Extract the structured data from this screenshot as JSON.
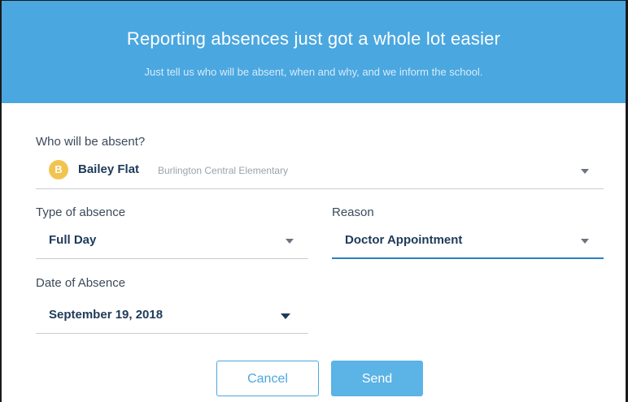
{
  "banner": {
    "title": "Reporting absences just got a whole lot easier",
    "subtitle": "Just tell us who will be absent, when and why, and we inform the school."
  },
  "student_field": {
    "label": "Who will be absent?",
    "avatar_initial": "B",
    "student_name": "Bailey Flat",
    "school": "Burlington Central Elementary",
    "icon": "caret-down-icon"
  },
  "type_field": {
    "label": "Type of absence",
    "value": "Full Day",
    "icon": "caret-down-icon"
  },
  "reason_field": {
    "label": "Reason",
    "value": "Doctor Appointment",
    "icon": "caret-down-icon"
  },
  "date_field": {
    "label": "Date of Absence",
    "value": "September 19, 2018",
    "icon": "caret-down-icon"
  },
  "actions": {
    "cancel_label": "Cancel",
    "send_label": "Send"
  },
  "colors": {
    "banner_bg": "#4aa7e0",
    "avatar_bg": "#f2c44f",
    "active_underline": "#2b7fbd",
    "send_bg": "#5bb3e6"
  }
}
